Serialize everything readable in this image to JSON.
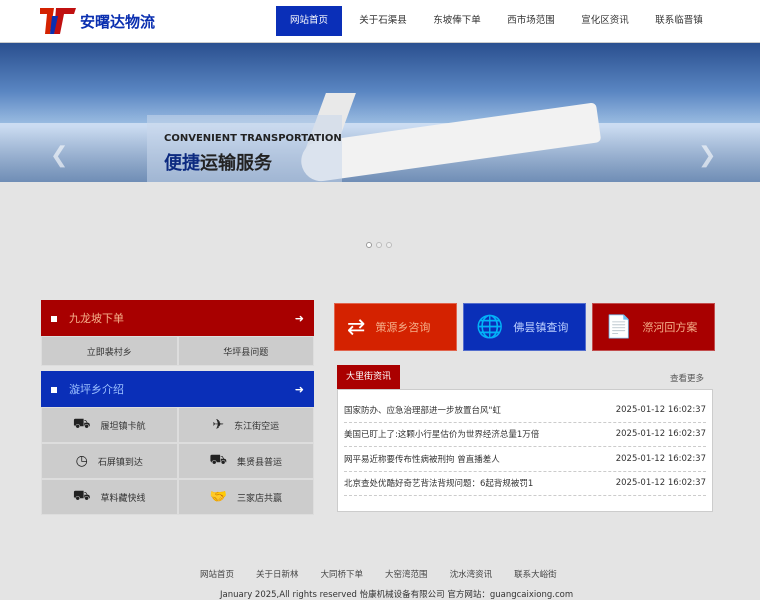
{
  "header": {
    "logo_text": "安曙达物流",
    "nav": [
      "网站首页",
      "关于石渠县",
      "东坡俸下单",
      "西市场范围",
      "宣化区资讯",
      "联系临晋镇"
    ]
  },
  "banner": {
    "en": "CONVENIENT TRANSPORTATION",
    "zh_a": "便捷",
    "zh_b": "运输服务"
  },
  "panel1": {
    "title": "九龙坡下单",
    "items": [
      "立即裴村乡",
      "华坪县问题"
    ]
  },
  "panel2": {
    "title": "漩坪乡介绍",
    "items": [
      {
        "icon": "truck-icon",
        "label": "履坦镇卡航"
      },
      {
        "icon": "airplane-icon",
        "label": "东江街空运"
      },
      {
        "icon": "clock-truck-icon",
        "label": "石屏镇到达"
      },
      {
        "icon": "container-truck-icon",
        "label": "集贤县普运"
      },
      {
        "icon": "van-icon",
        "label": "草料藏快线"
      },
      {
        "icon": "handshake-icon",
        "label": "三家店共赢"
      }
    ]
  },
  "tiles": [
    {
      "label": "策源乡咨询",
      "color": "#d42200",
      "icon": "users-exchange-icon"
    },
    {
      "label": "佛昙镇查询",
      "color": "#0a2fb8",
      "icon": "globe-plane-icon"
    },
    {
      "label": "漈河回方案",
      "color": "#a80000",
      "icon": "cv-document-icon"
    }
  ],
  "news": {
    "tab": "大里街资讯",
    "more": "查看更多",
    "items": [
      {
        "title": "国家防办、应急治理部进一步放置台风\"虹",
        "date": "2025-01-12 16:02:37"
      },
      {
        "title": "美国已盯上了:这颗小行星估价为世界经济总量1万倍",
        "date": "2025-01-12 16:02:37"
      },
      {
        "title": "网平易近称要传布性病被刑拘 曾直播差人",
        "date": "2025-01-12 16:02:37"
      },
      {
        "title": "北京查处优酷好奇艺背法背规问题：6起背规被罚1",
        "date": "2025-01-12 16:02:37"
      }
    ]
  },
  "footer": {
    "links": [
      "网站首页",
      "关于日新林",
      "大同桥下单",
      "大窑湾范围",
      "沈水湾资讯",
      "联系大峪街"
    ],
    "copyright": "January 2025,All rights reserved 怡康机械设备有限公司 官方网站：guangcaixiong.com"
  }
}
